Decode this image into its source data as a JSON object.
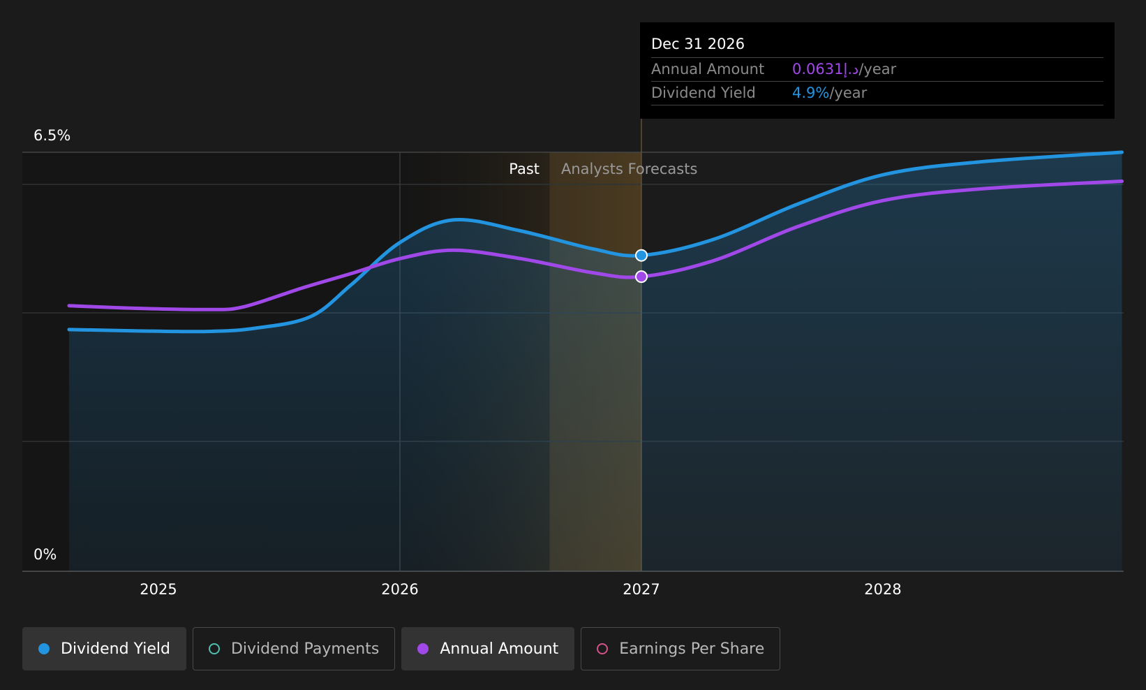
{
  "chart_data": {
    "type": "line",
    "y_tick_labels": [
      "0%",
      "6.5%"
    ],
    "ylim": [
      0,
      6.5
    ],
    "x_tick_labels": [
      "2025",
      "2026",
      "2027",
      "2028"
    ],
    "xlim": [
      2024.44,
      2028.99
    ],
    "past_forecast_boundary": 2027.0,
    "region_labels": {
      "past": "Past",
      "forecast": "Analysts Forecasts"
    },
    "grid": "horizontal",
    "series": [
      {
        "name": "Dividend Yield",
        "color": "#2394df",
        "points": [
          [
            2024.63,
            3.75
          ],
          [
            2024.9,
            3.73
          ],
          [
            2025.2,
            3.72
          ],
          [
            2025.4,
            3.77
          ],
          [
            2025.63,
            3.95
          ],
          [
            2025.8,
            4.45
          ],
          [
            2026.0,
            5.1
          ],
          [
            2026.22,
            5.45
          ],
          [
            2026.5,
            5.28
          ],
          [
            2026.8,
            5.0
          ],
          [
            2027.0,
            4.9
          ],
          [
            2027.3,
            5.15
          ],
          [
            2027.65,
            5.7
          ],
          [
            2028.0,
            6.15
          ],
          [
            2028.4,
            6.35
          ],
          [
            2028.99,
            6.5
          ]
        ]
      },
      {
        "name": "Annual Amount",
        "color": "#a049e8",
        "points": [
          [
            2024.63,
            4.12
          ],
          [
            2024.9,
            4.08
          ],
          [
            2025.2,
            4.06
          ],
          [
            2025.35,
            4.1
          ],
          [
            2025.6,
            4.4
          ],
          [
            2025.8,
            4.62
          ],
          [
            2026.0,
            4.85
          ],
          [
            2026.22,
            4.98
          ],
          [
            2026.5,
            4.85
          ],
          [
            2026.8,
            4.63
          ],
          [
            2027.0,
            4.57
          ],
          [
            2027.3,
            4.82
          ],
          [
            2027.65,
            5.35
          ],
          [
            2028.0,
            5.75
          ],
          [
            2028.4,
            5.93
          ],
          [
            2028.99,
            6.05
          ]
        ]
      }
    ],
    "tooltip": {
      "date": "Dec 31 2026",
      "rows": [
        {
          "label": "Annual Amount",
          "value": "0.0631د.إ",
          "unit": "/year",
          "color": "#a049e8"
        },
        {
          "label": "Dividend Yield",
          "value": "4.9%",
          "unit": "/year",
          "color": "#2394df"
        }
      ]
    },
    "legend": [
      {
        "label": "Dividend Yield",
        "color": "#2394df",
        "active": true
      },
      {
        "label": "Dividend Payments",
        "color": "#4fc1b0",
        "active": false
      },
      {
        "label": "Annual Amount",
        "color": "#a049e8",
        "active": true
      },
      {
        "label": "Earnings Per Share",
        "color": "#d4528a",
        "active": false
      }
    ]
  }
}
